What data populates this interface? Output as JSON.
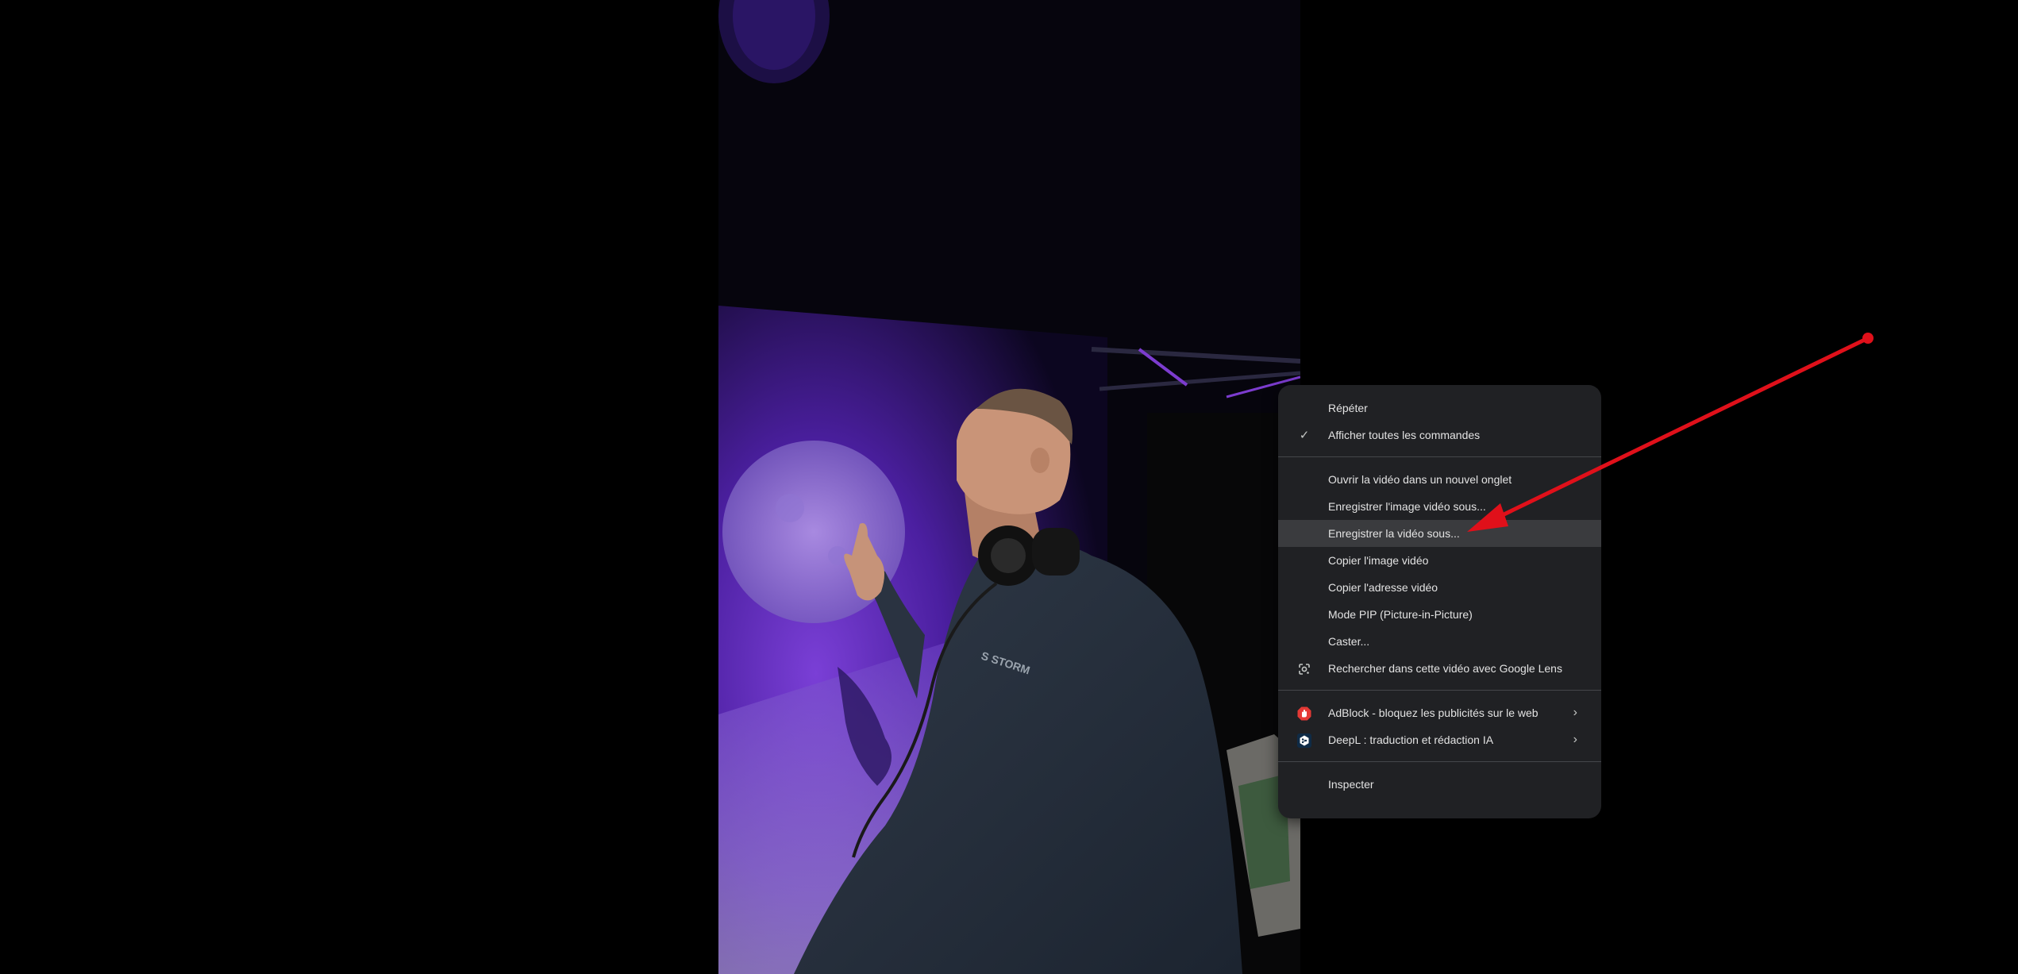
{
  "video": {
    "shirt_logo": "S STORM"
  },
  "context_menu": {
    "items": [
      {
        "label": "Répéter"
      },
      {
        "label": "Afficher toutes les commandes",
        "icon": "check-icon",
        "checked": true
      },
      {
        "label": "Ouvrir la vidéo dans un nouvel onglet"
      },
      {
        "label": "Enregistrer l'image vidéo sous..."
      },
      {
        "label": "Enregistrer la vidéo sous...",
        "highlighted": true
      },
      {
        "label": "Copier l'image vidéo"
      },
      {
        "label": "Copier l'adresse vidéo"
      },
      {
        "label": "Mode PIP (Picture-in-Picture)"
      },
      {
        "label": "Caster..."
      },
      {
        "label": "Rechercher dans cette vidéo avec Google Lens",
        "icon": "google-lens-icon"
      },
      {
        "label": "AdBlock - bloquez les publicités sur le web",
        "icon": "adblock-icon",
        "submenu": true
      },
      {
        "label": "DeepL : traduction et rédaction IA",
        "icon": "deepl-icon",
        "submenu": true
      },
      {
        "label": "Inspecter"
      }
    ],
    "submenu_glyph": "›",
    "check_glyph": "✓"
  },
  "colors": {
    "menu_bg": "#202124",
    "menu_highlight": "#3a3b3e",
    "annotation_arrow": "#e0101a",
    "adblock_red": "#e53935",
    "deepl_bg": "#0f2b46"
  }
}
